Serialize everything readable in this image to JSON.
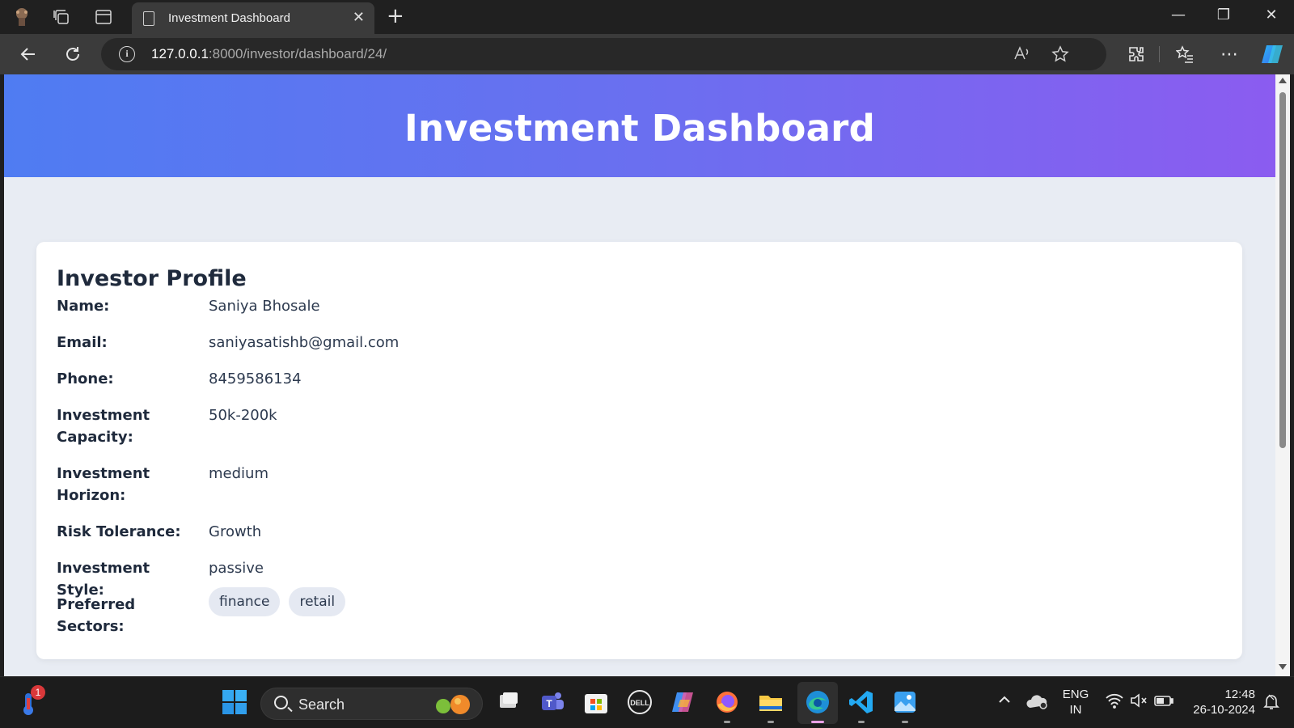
{
  "browser": {
    "tab_title": "Investment Dashboard",
    "url_host": "127.0.0.1",
    "url_rest": ":8000/investor/dashboard/24/"
  },
  "page": {
    "header_title": "Investment Dashboard",
    "profile_heading": "Investor Profile",
    "fields": [
      {
        "label": "Name:",
        "value": "Saniya Bhosale"
      },
      {
        "label": "Email:",
        "value": "saniyasatishb@gmail.com"
      },
      {
        "label": "Phone:",
        "value": "8459586134"
      },
      {
        "label": "Investment Capacity:",
        "value": "50k-200k"
      },
      {
        "label": "Investment Horizon:",
        "value": "medium"
      },
      {
        "label": "Risk Tolerance:",
        "value": "Growth"
      },
      {
        "label": "Investment Style:",
        "value": "passive"
      },
      {
        "label": "Preferred Sectors:",
        "value": ""
      }
    ],
    "preferred_sectors": [
      "finance",
      "retail"
    ]
  },
  "taskbar": {
    "search_label": "Search",
    "notification_count": "1",
    "language_line1": "ENG",
    "language_line2": "IN",
    "time": "12:48",
    "date": "26-10-2024"
  },
  "colors": {
    "header_gradient_start": "#4f7cf2",
    "header_gradient_end": "#8b5cf0",
    "page_background": "#e8ecf3",
    "chip_background": "#e5e9f2"
  }
}
